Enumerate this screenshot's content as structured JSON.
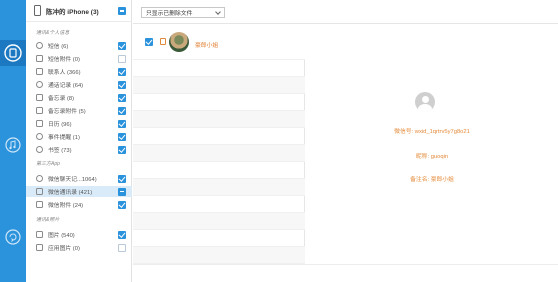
{
  "rail": {
    "icons": [
      "transfer-icon",
      "music-icon",
      "backup-icon"
    ]
  },
  "device": {
    "name": "陈冲的 iPhone (3)",
    "check_state": "partial"
  },
  "sections": {
    "personal": "通讯&个人信息",
    "third_party": "第三方App",
    "media": "通讯&照片"
  },
  "categories": [
    {
      "label": "短信 (6)",
      "checked": true
    },
    {
      "label": "短信附件 (0)",
      "checked": false
    },
    {
      "label": "联系人 (366)",
      "checked": true
    },
    {
      "label": "通话记录 (64)",
      "checked": true
    },
    {
      "label": "备忘录 (8)",
      "checked": true
    },
    {
      "label": "备忘录附件 (5)",
      "checked": true
    },
    {
      "label": "日历 (96)",
      "checked": true
    },
    {
      "label": "事件提醒 (1)",
      "checked": true
    },
    {
      "label": "书签 (73)",
      "checked": true
    },
    {
      "label": "微信聊天记...1064)",
      "checked": true
    },
    {
      "label": "微信通讯录 (421)",
      "checked": "partial",
      "selected": true
    },
    {
      "label": "微信附件 (24)",
      "checked": true
    },
    {
      "label": "图片 (540)",
      "checked": true
    },
    {
      "label": "应用图片 (0)",
      "checked": false
    }
  ],
  "filter": {
    "selected": "只显示已删除文件"
  },
  "contact_list": {
    "first_name": "豪郎小姐",
    "row_count": 13
  },
  "detail": {
    "wechat_id": "微信号: wxid_1qrtrv5y7g8o21",
    "nickname": "昵称: guoqin",
    "remark": "备注名: 豪郎小姐"
  },
  "colors": {
    "accent": "#2b92dc",
    "highlight": "#e48a3a",
    "selected_row": "#d9ebf9"
  }
}
